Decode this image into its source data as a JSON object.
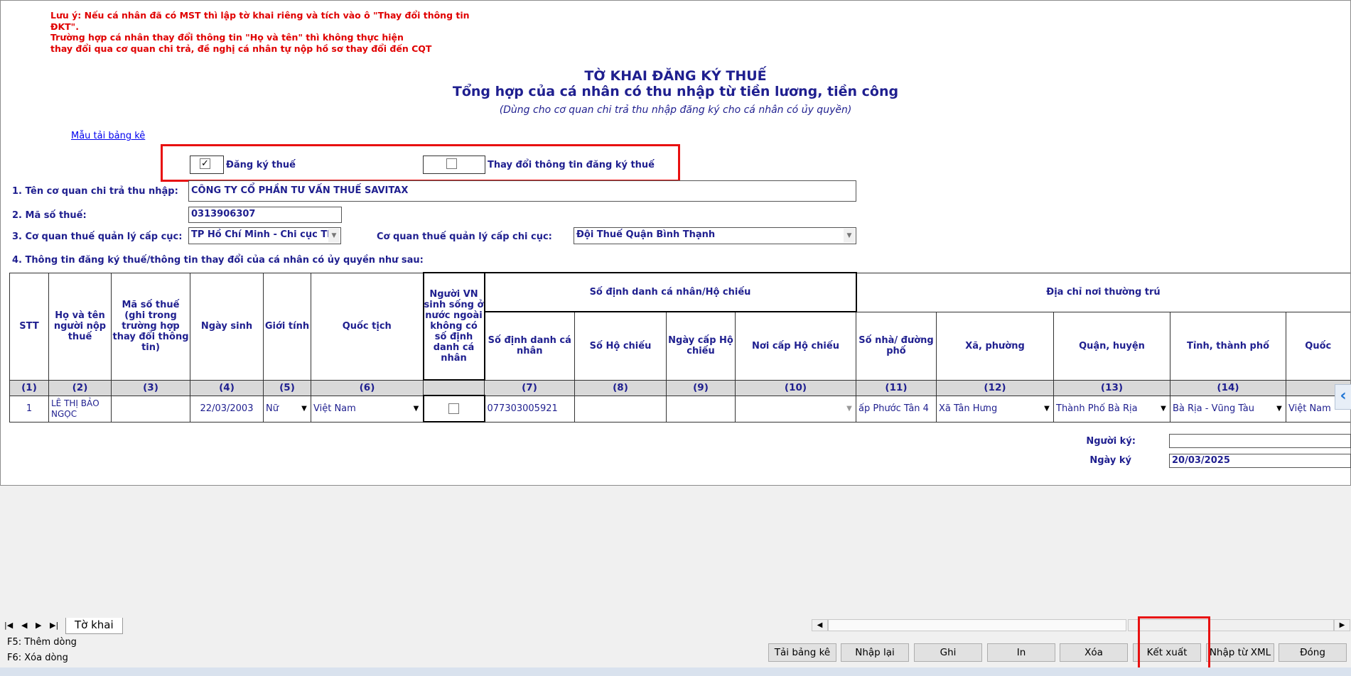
{
  "note": {
    "line1": "Lưu ý: Nếu cá nhân đã có MST thì lập tờ khai riêng và tích vào ô \"Thay đổi thông tin",
    "line2": "ĐKT\".",
    "line3": "Trường hợp cá nhân thay đổi thông tin \"Họ và tên\" thì không thực hiện",
    "line4": "thay đổi qua cơ quan chi trả, đề nghị cá nhân tự nộp hồ sơ thay đổi đến CQT"
  },
  "header": {
    "title": "TỜ KHAI ĐĂNG KÝ THUẾ",
    "subtitle": "Tổng hợp của cá nhân có thu nhập từ tiền lương, tiền công",
    "note": "(Dùng cho cơ quan chi trả thu nhập đăng ký cho cá nhân có ủy quyền)"
  },
  "template_link": "Mẫu tải bảng kê",
  "options": {
    "register_label": "Đăng ký thuế",
    "register_checked": "✓",
    "change_label": "Thay đổi thông tin đăng ký thuế"
  },
  "form": {
    "org_label": "1. Tên cơ quan chi trả thu nhập:",
    "org_value": "CÔNG TY CỔ PHẦN TƯ VẤN THUẾ SAVITAX",
    "tax_label": "2. Mã số thuế:",
    "tax_value": "0313906307",
    "dept_label": "3. Cơ quan thuế quản lý cấp cục:",
    "dept_value": "TP Hồ Chí Minh - Chi cục Thu",
    "branch_label": "Cơ quan thuế quản lý cấp chi cục:",
    "branch_value": "Đội Thuế Quận Bình Thạnh",
    "section4_label": "4. Thông tin đăng ký thuế/thông tin thay đổi của cá nhân có ủy quyền như sau:"
  },
  "table": {
    "headers": {
      "stt": "STT",
      "name": "Họ và tên người nộp thuế",
      "mst": "Mã số thuế (ghi trong trường hợp thay đổi thông tin)",
      "dob": "Ngày sinh",
      "gender": "Giới tính",
      "nationality": "Quốc tịch",
      "abroad": "Người VN sinh sống ở nước ngoài không có số định danh cá nhân",
      "id_group": "Số định danh cá nhân/Hộ chiếu",
      "id_no": "Số định danh cá nhân",
      "passport": "Số Hộ chiếu",
      "passport_date": "Ngày cấp Hộ chiếu",
      "passport_place": "Nơi cấp Hộ chiếu",
      "addr_group": "Địa chỉ nơi thường trú",
      "street": "Số nhà/ đường phố",
      "ward": "Xã, phường",
      "district": "Quận, huyện",
      "province": "Tỉnh, thành phố",
      "country": "Quốc"
    },
    "numbers": [
      "(1)",
      "(2)",
      "(3)",
      "(4)",
      "(5)",
      "(6)",
      "",
      "(7)",
      "(8)",
      "(9)",
      "(10)",
      "(11)",
      "(12)",
      "(13)",
      "(14)",
      ""
    ],
    "row": {
      "stt": "1",
      "name": "LÊ THỊ BẢO NGỌC",
      "mst": "",
      "dob": "22/03/2003",
      "gender": "Nữ",
      "nationality": "Việt Nam",
      "id_no": "077303005921",
      "passport": "",
      "passport_date": "",
      "passport_place": "",
      "street": "ấp Phước Tân 4",
      "ward": "Xã Tân Hưng",
      "district": "Thành Phố Bà Rịa",
      "province": "Bà Rịa - Vũng Tàu",
      "country": "Việt Nam"
    }
  },
  "signer": {
    "signer_label": "Người ký:",
    "signer_value": "",
    "date_label": "Ngày ký",
    "date_value": "20/03/2025"
  },
  "sheet_tab": "Tờ khai",
  "hints": {
    "f5": "F5: Thêm dòng",
    "f6": "F6: Xóa dòng"
  },
  "buttons": {
    "load": "Tải bảng kê",
    "reset": "Nhập lại",
    "save": "Ghi",
    "print": "In",
    "delete": "Xóa",
    "export": "Kết xuất",
    "import_xml": "Nhập từ XML",
    "close": "Đóng"
  },
  "colors": {
    "accent_red": "#e81010",
    "label_blue": "#1f1f8f",
    "header_gray": "#d9d9d9"
  }
}
